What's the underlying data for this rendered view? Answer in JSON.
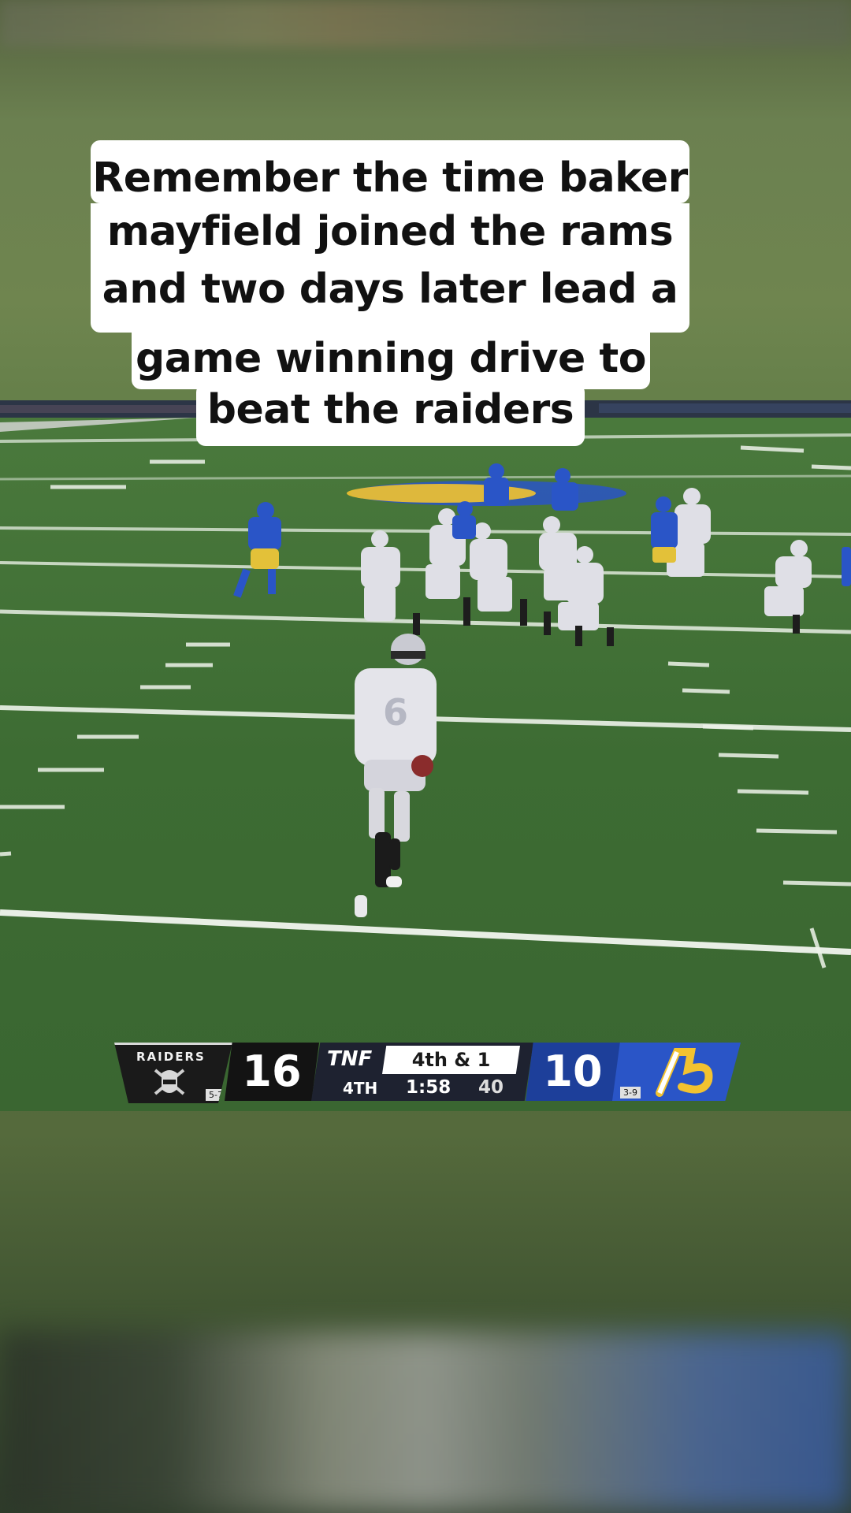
{
  "caption": {
    "lines": [
      "Remember the time baker",
      "mayfield joined the rams",
      "and two days later lead a",
      "game winning drive to",
      "beat the raiders"
    ]
  },
  "scorebug": {
    "away_team": "RAIDERS",
    "away_score": "16",
    "away_record": "5-7",
    "network": "TNF",
    "down_distance": "4th & 1",
    "quarter": "4TH",
    "game_clock": "1:58",
    "play_clock": "40",
    "home_score": "10",
    "home_record": "3-9"
  },
  "colors": {
    "field_green": "#3f6b35",
    "rams_blue": "#2a55c7",
    "rams_yellow": "#f2c230",
    "raiders_black": "#131313"
  }
}
